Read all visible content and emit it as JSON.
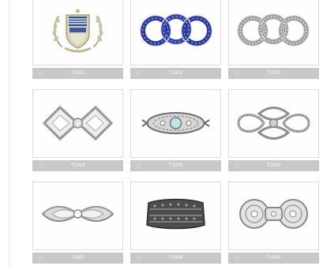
{
  "products": [
    {
      "code": "T1001",
      "image": "crest-brooch-image"
    },
    {
      "code": "T1002",
      "image": "blue-rings-brooch-image"
    },
    {
      "code": "T1003",
      "image": "silver-rings-brooch-image"
    },
    {
      "code": "T1004",
      "image": "double-diamond-brooch-image"
    },
    {
      "code": "T1005",
      "image": "oval-filigree-brooch-image"
    },
    {
      "code": "T1006",
      "image": "knot-brooch-image"
    },
    {
      "code": "T1007",
      "image": "bow-brooch-image"
    },
    {
      "code": "T1008",
      "image": "marcasite-bar-brooch-image"
    },
    {
      "code": "T1009",
      "image": "scroll-brooch-image"
    }
  ],
  "icons": {
    "favorite": "star-outline-icon"
  },
  "colors": {
    "caption_bar": "#c8c8c8",
    "card_border": "#dcdcdc",
    "star": "#e2e2e2"
  }
}
